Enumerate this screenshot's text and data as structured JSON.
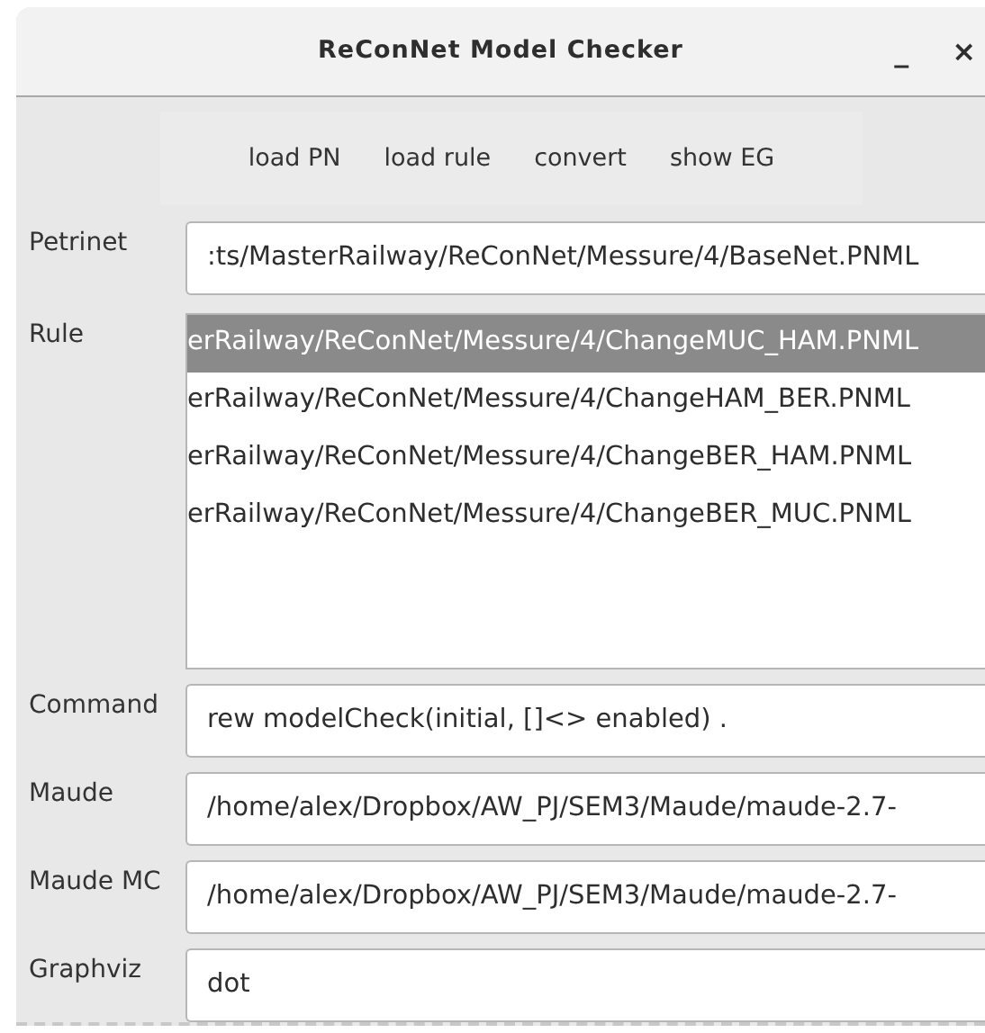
{
  "window": {
    "title": "ReConNet Model Checker",
    "controls": [
      "_",
      "×"
    ]
  },
  "toolbar": [
    "load PN",
    "load rule",
    "convert",
    "show EG"
  ],
  "fields": [
    {
      "kind": "text",
      "label": "Petrinet",
      "value": ":ts/MasterRailway/ReConNet/Messure/4/BaseNet.PNML"
    },
    {
      "kind": "list",
      "label": "Rule",
      "items": [
        {
          "text": "erRailway/ReConNet/Messure/4/ChangeMUC_HAM.PNML",
          "selected": true
        },
        {
          "text": "erRailway/ReConNet/Messure/4/ChangeHAM_BER.PNML",
          "selected": false
        },
        {
          "text": "erRailway/ReConNet/Messure/4/ChangeBER_HAM.PNML",
          "selected": false
        },
        {
          "text": "erRailway/ReConNet/Messure/4/ChangeBER_MUC.PNML",
          "selected": false
        }
      ]
    },
    {
      "kind": "text",
      "label": "Command",
      "value": "rew modelCheck(initial, []<> enabled) ."
    },
    {
      "kind": "text",
      "label": "Maude",
      "value": "/home/alex/Dropbox/AW_PJ/SEM3/Maude/maude-2.7-"
    },
    {
      "kind": "text",
      "label": "Maude MC",
      "value": "/home/alex/Dropbox/AW_PJ/SEM3/Maude/maude-2.7-"
    },
    {
      "kind": "text",
      "label": "Graphviz",
      "value": "dot"
    }
  ]
}
